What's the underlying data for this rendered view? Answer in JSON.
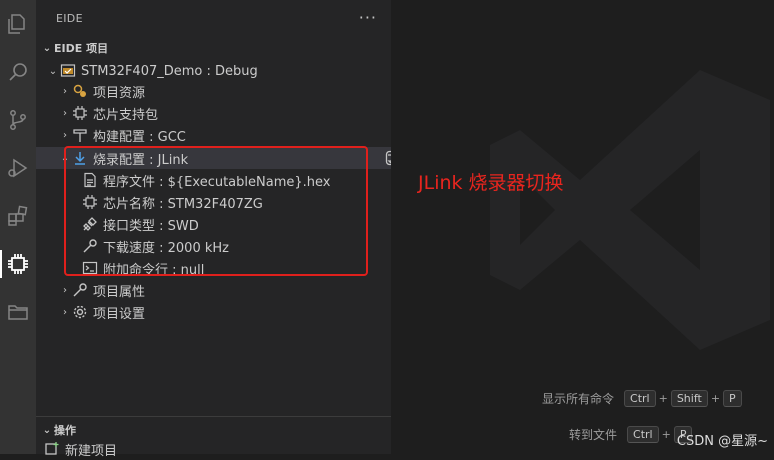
{
  "sidebar": {
    "title": "EIDE",
    "more": "···",
    "section_title": "EIDE 项目",
    "project": "STM32F407_Demo : Debug",
    "items": [
      {
        "label": "项目资源"
      },
      {
        "label": "芯片支持包"
      },
      {
        "label": "构建配置 : GCC"
      },
      {
        "label": "烧录配置 : JLink"
      }
    ],
    "flash_children": [
      {
        "label": "程序文件 : ${ExecutableName}.hex"
      },
      {
        "label": "芯片名称 : STM32F407ZG"
      },
      {
        "label": "接口类型 : SWD"
      },
      {
        "label": "下载速度 : 2000 kHz"
      },
      {
        "label": "附加命令行 : null"
      }
    ],
    "items_after": [
      {
        "label": "项目属性"
      },
      {
        "label": "项目设置"
      }
    ],
    "ops_section_title": "操作",
    "ops_items": [
      {
        "label": "新建项目"
      }
    ]
  },
  "annotation": "JLink 烧录器切换",
  "shortcuts": [
    {
      "label": "显示所有命令",
      "keys": [
        "Ctrl",
        "Shift",
        "P"
      ]
    },
    {
      "label": "转到文件",
      "keys": [
        "Ctrl",
        "P"
      ]
    }
  ],
  "watermark_text": "CSDN @星源~",
  "colors": {
    "annotation": "#e8251e",
    "box": "#e0201c",
    "sidebar": "#252526",
    "activity": "#333333"
  }
}
